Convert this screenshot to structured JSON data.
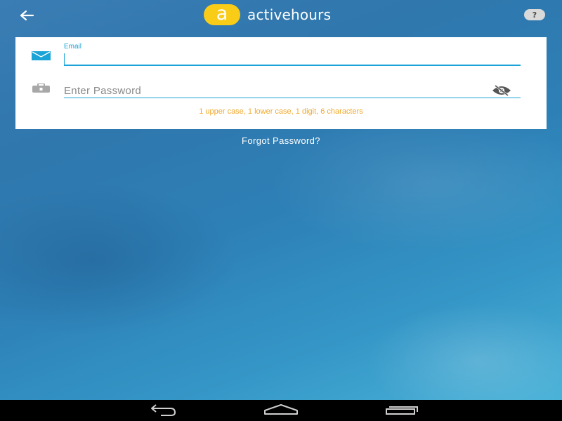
{
  "header": {
    "logo_letter": "a",
    "app_name": "activehours",
    "help_label": "?",
    "back_icon": "arrow-left-icon"
  },
  "form": {
    "email": {
      "label": "Email",
      "value": "",
      "icon": "envelope-icon"
    },
    "password": {
      "placeholder": "Enter Password",
      "value": "",
      "icon": "lock-icon",
      "toggle_icon": "eye-off-icon",
      "hint": "1 upper case, 1 lower case, 1 digit, 6 characters"
    }
  },
  "forgot_password_label": "Forgot Password?",
  "navbar": {
    "icons": [
      "back-icon",
      "home-icon",
      "recent-apps-icon"
    ]
  },
  "colors": {
    "accent": "#1aa3d6",
    "brand_yellow": "#f9cc17",
    "hint_orange": "#f0a82a",
    "card_background": "#ffffff"
  }
}
